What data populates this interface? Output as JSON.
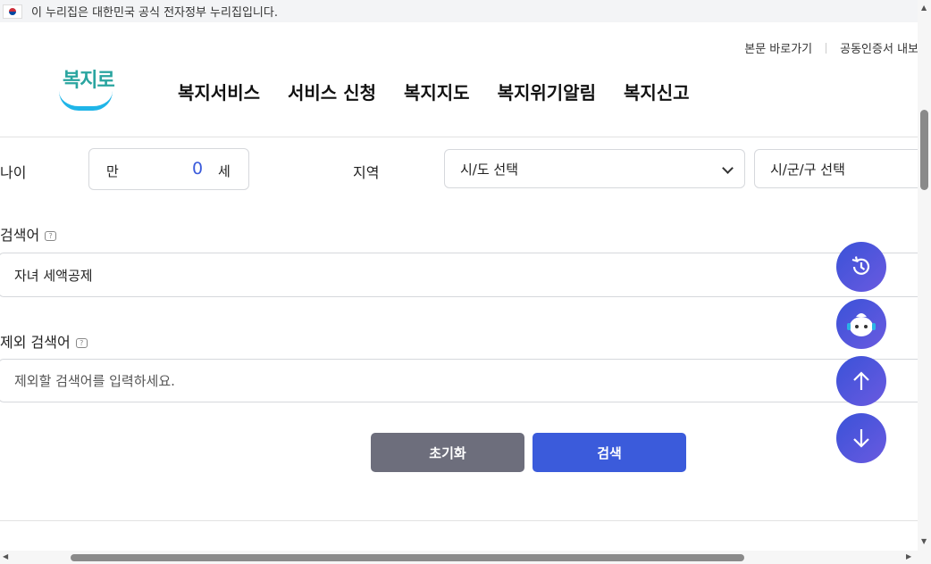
{
  "gov_banner": {
    "text": "이 누리집은 대한민국 공식 전자정부 누리집입니다."
  },
  "util_links": [
    "본문 바로가기",
    "공동인증서 내보"
  ],
  "logo": {
    "text": "복지로"
  },
  "gnb": [
    "복지서비스",
    "서비스 신청",
    "복지지도",
    "복지위기알림",
    "복지신고"
  ],
  "filters": {
    "age_label": "나이",
    "age_prefix": "만",
    "age_value": "0",
    "age_suffix": "세",
    "region_label": "지역",
    "sido_value": "시/도 선택",
    "sigungu_value": "시/군/구 선택"
  },
  "search": {
    "keyword_label": "검색어",
    "keyword_value": "자녀 세액공제",
    "exclude_label": "제외 검색어",
    "exclude_placeholder": "제외할 검색어를 입력하세요."
  },
  "buttons": {
    "reset": "초기화",
    "search": "검색"
  },
  "floating": [
    "history-icon",
    "chatbot-icon",
    "arrow-up-icon",
    "arrow-down-icon"
  ],
  "colors": {
    "primary": "#3b5bdb",
    "reset_button": "#6d6e7c",
    "age_value": "#3b5bdb"
  }
}
